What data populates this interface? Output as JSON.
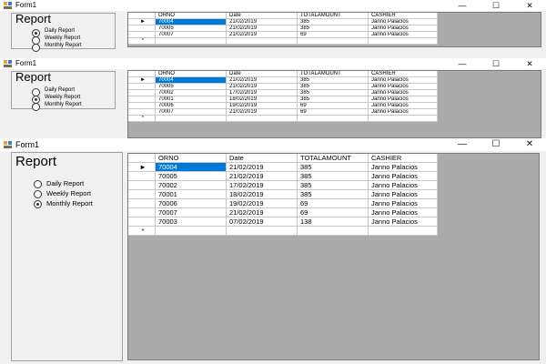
{
  "window": {
    "title": "Form1",
    "minimize_glyph": "—",
    "maximize_glyph": "☐",
    "close_glyph": "✕"
  },
  "report": {
    "heading": "Report",
    "options": [
      "Daily Report",
      "Weekly Report",
      "Monthly Report"
    ]
  },
  "grid": {
    "columns": [
      "ORNO",
      "Date",
      "TOTALAMOUNT",
      "CASHIER"
    ],
    "current_row_marker": "►",
    "new_row_marker": "*"
  },
  "windows": [
    {
      "selected_option": "Daily Report",
      "rows": [
        [
          "70004",
          "21/02/2019",
          "385",
          "Janno Palacios"
        ],
        [
          "70005",
          "21/02/2019",
          "385",
          "Janno Palacios"
        ],
        [
          "70007",
          "21/02/2019",
          "69",
          "Janno Palacios"
        ]
      ]
    },
    {
      "selected_option": "Weekly Report",
      "rows": [
        [
          "70004",
          "21/02/2019",
          "385",
          "Janno Palacios"
        ],
        [
          "70005",
          "21/02/2019",
          "385",
          "Janno Palacios"
        ],
        [
          "70002",
          "17/02/2019",
          "385",
          "Janno Palacios"
        ],
        [
          "70001",
          "18/02/2019",
          "385",
          "Janno Palacios"
        ],
        [
          "70006",
          "19/02/2019",
          "69",
          "Janno Palacios"
        ],
        [
          "70007",
          "21/02/2019",
          "69",
          "Janno Palacios"
        ]
      ]
    },
    {
      "selected_option": "Monthly Report",
      "rows": [
        [
          "70004",
          "21/02/2019",
          "385",
          "Janno Palacios"
        ],
        [
          "70005",
          "21/02/2019",
          "385",
          "Janno Palacios"
        ],
        [
          "70002",
          "17/02/2019",
          "385",
          "Janno Palacios"
        ],
        [
          "70001",
          "18/02/2019",
          "385",
          "Janno Palacios"
        ],
        [
          "70006",
          "19/02/2019",
          "69",
          "Janno Palacios"
        ],
        [
          "70007",
          "21/02/2019",
          "69",
          "Janno Palacios"
        ],
        [
          "70003",
          "07/02/2019",
          "138",
          "Janno Palacios"
        ]
      ]
    }
  ]
}
